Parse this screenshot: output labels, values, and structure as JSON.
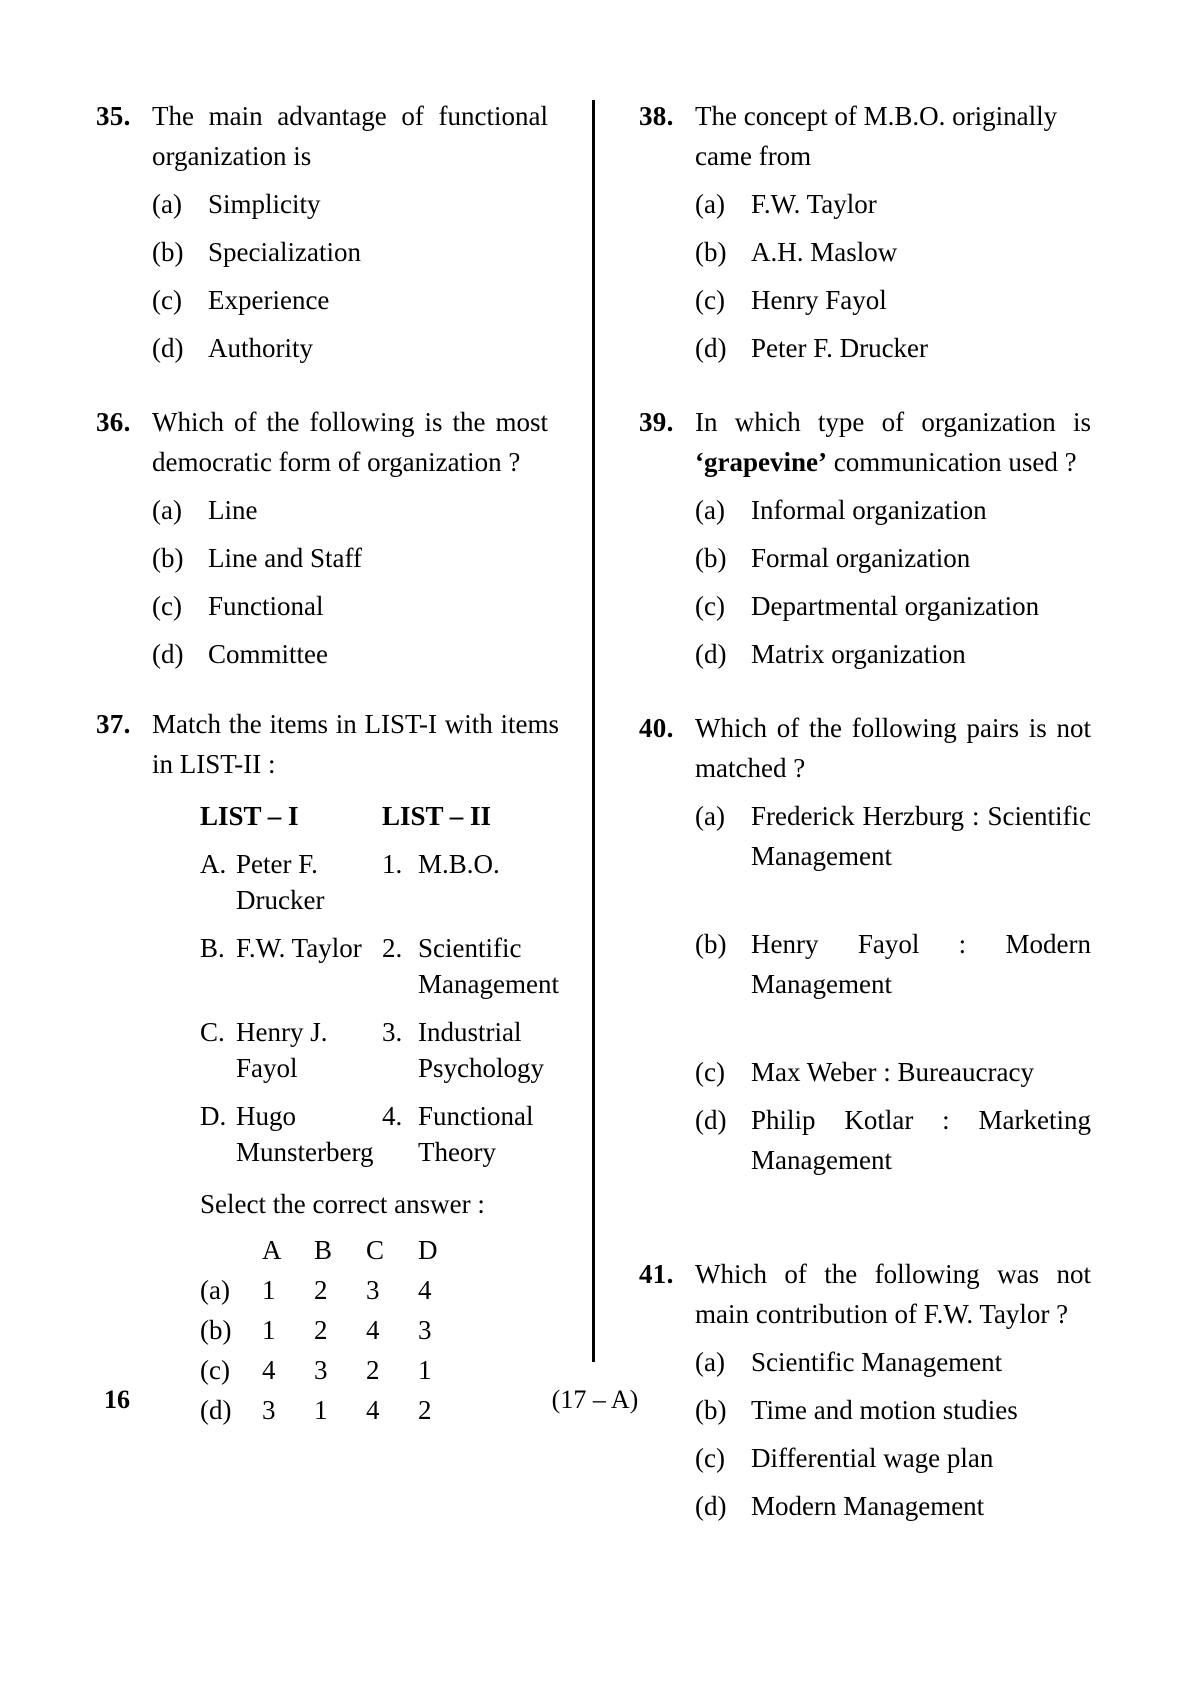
{
  "footer": {
    "page_number": "16",
    "paper_code": "(17 – A)"
  },
  "left_column": {
    "questions": [
      {
        "number": "35.",
        "text": "The main advantage of functional organization is",
        "options": [
          {
            "key": "(a)",
            "value": "Simplicity"
          },
          {
            "key": "(b)",
            "value": "Specialization"
          },
          {
            "key": "(c)",
            "value": "Experience"
          },
          {
            "key": "(d)",
            "value": "Authority"
          }
        ]
      },
      {
        "number": "36.",
        "text": "Which of the following is the most democratic form of organization ?",
        "options": [
          {
            "key": "(a)",
            "value": "Line"
          },
          {
            "key": "(b)",
            "value": "Line and Staff"
          },
          {
            "key": "(c)",
            "value": "Functional"
          },
          {
            "key": "(d)",
            "value": "Committee"
          }
        ]
      },
      {
        "number": "37.",
        "text": "Match the items in LIST-I with items in LIST-II :",
        "list_headers": {
          "left": "LIST – I",
          "right": "LIST – II"
        },
        "match_rows": [
          {
            "left_key": "A.",
            "left_text": "Peter F. Drucker",
            "right_key": "1.",
            "right_text": "M.B.O."
          },
          {
            "left_key": "B.",
            "left_text": "F.W. Taylor",
            "right_key": "2.",
            "right_text": "Scientific Management"
          },
          {
            "left_key": "C.",
            "left_text": "Henry J. Fayol",
            "right_key": "3.",
            "right_text": "Industrial Psychology"
          },
          {
            "left_key": "D.",
            "left_text": "Hugo Munsterberg",
            "right_key": "4.",
            "right_text": "Functional Theory"
          }
        ],
        "select_label": "Select the correct answer :",
        "grid_headers": [
          "A",
          "B",
          "C",
          "D"
        ],
        "grid_rows": [
          {
            "key": "(a)",
            "values": [
              "1",
              "2",
              "3",
              "4"
            ]
          },
          {
            "key": "(b)",
            "values": [
              "1",
              "2",
              "4",
              "3"
            ]
          },
          {
            "key": "(c)",
            "values": [
              "4",
              "3",
              "2",
              "1"
            ]
          },
          {
            "key": "(d)",
            "values": [
              "3",
              "1",
              "4",
              "2"
            ]
          }
        ]
      }
    ]
  },
  "right_column": {
    "questions": [
      {
        "number": "38.",
        "text": "The concept of M.B.O. originally came from",
        "options": [
          {
            "key": "(a)",
            "value": "F.W. Taylor"
          },
          {
            "key": "(b)",
            "value": "A.H. Maslow"
          },
          {
            "key": "(c)",
            "value": "Henry Fayol"
          },
          {
            "key": "(d)",
            "value": "Peter F. Drucker"
          }
        ]
      },
      {
        "number": "39.",
        "text_before_bold": "In which type of organization is ",
        "text_bold": "‘grapevine’",
        "text_after_bold": " communication used ?",
        "options": [
          {
            "key": "(a)",
            "value": "Informal organization"
          },
          {
            "key": "(b)",
            "value": "Formal organization"
          },
          {
            "key": "(c)",
            "value": "Departmental organization"
          },
          {
            "key": "(d)",
            "value": "Matrix organization"
          }
        ]
      },
      {
        "number": "40.",
        "text": "Which of the following pairs is not matched ?",
        "options": [
          {
            "key": "(a)",
            "value": "Frederick Herzburg : Scientific Management",
            "justify": true
          },
          {
            "key": "(b)",
            "value": "Henry Fayol : Modern Management",
            "justify": true
          },
          {
            "key": "(c)",
            "value": "Max Weber : Bureaucracy",
            "justify": false
          },
          {
            "key": "(d)",
            "value": "Philip Kotlar : Marketing Management",
            "justify": true
          }
        ]
      },
      {
        "number": "41.",
        "text": "Which of the following was not main contribution of F.W. Taylor ?",
        "options": [
          {
            "key": "(a)",
            "value": "Scientific Management"
          },
          {
            "key": "(b)",
            "value": "Time and motion studies"
          },
          {
            "key": "(c)",
            "value": "Differential wage plan"
          },
          {
            "key": "(d)",
            "value": "Modern Management"
          }
        ]
      }
    ]
  }
}
